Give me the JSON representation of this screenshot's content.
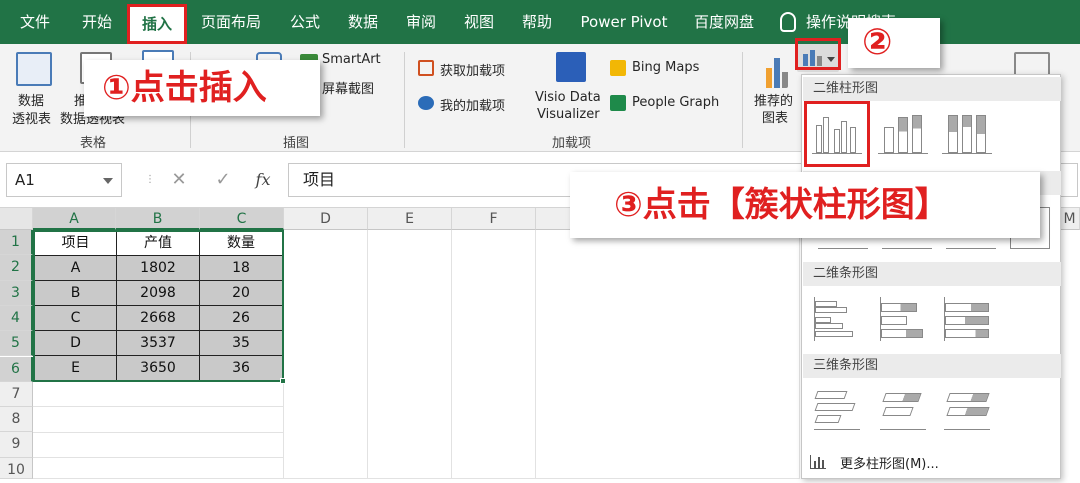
{
  "tabs": [
    {
      "label": "文件"
    },
    {
      "label": "开始"
    },
    {
      "label": "插入"
    },
    {
      "label": "页面布局"
    },
    {
      "label": "公式"
    },
    {
      "label": "数据"
    },
    {
      "label": "审阅"
    },
    {
      "label": "视图"
    },
    {
      "label": "帮助"
    },
    {
      "label": "Power Pivot"
    },
    {
      "label": "百度网盘"
    },
    {
      "label": "操作说明搜索"
    }
  ],
  "ribbon": {
    "pivot_label_1": "数据",
    "pivot_label_2": "透视表",
    "recommend_pivot_1": "推荐的",
    "recommend_pivot_2": "数据透视表",
    "tables_group": "表格",
    "smartart": "SmartArt",
    "screenshot": "屏幕截图",
    "illustrations_group": "插图",
    "get_addins": "获取加载项",
    "my_addins": "我的加载项",
    "visio_1": "Visio Data",
    "visio_2": "Visualizer",
    "bing_maps": "Bing Maps",
    "people_graph": "People Graph",
    "addins_group": "加载项",
    "recommended_charts_1": "推荐的",
    "recommended_charts_2": "图表"
  },
  "formula_bar": {
    "name_box": "A1",
    "cancel": "✕",
    "enter": "✓",
    "fx": "fx",
    "content": "项目"
  },
  "grid": {
    "columns": [
      "A",
      "B",
      "C",
      "D",
      "E",
      "F",
      "M"
    ],
    "rows": [
      "1",
      "2",
      "3",
      "4",
      "5",
      "6",
      "7",
      "8",
      "9",
      "10"
    ],
    "table_headers": [
      "项目",
      "产值",
      "数量"
    ],
    "table_rows": [
      [
        "A",
        "1802",
        "18"
      ],
      [
        "B",
        "2098",
        "20"
      ],
      [
        "C",
        "2668",
        "26"
      ],
      [
        "D",
        "3537",
        "35"
      ],
      [
        "E",
        "3650",
        "36"
      ]
    ]
  },
  "chart_menu": {
    "section_2d_column": "二维柱形图",
    "section_2d_bar": "二维条形图",
    "section_3d_bar": "三维条形图",
    "more_charts": "更多柱形图(M)..."
  },
  "callouts": {
    "step1": "①点击插入",
    "step2": "②",
    "step3": "③点击【簇状柱形图】"
  },
  "colors": {
    "excel_green": "#217346",
    "highlight_red": "#e02020"
  }
}
